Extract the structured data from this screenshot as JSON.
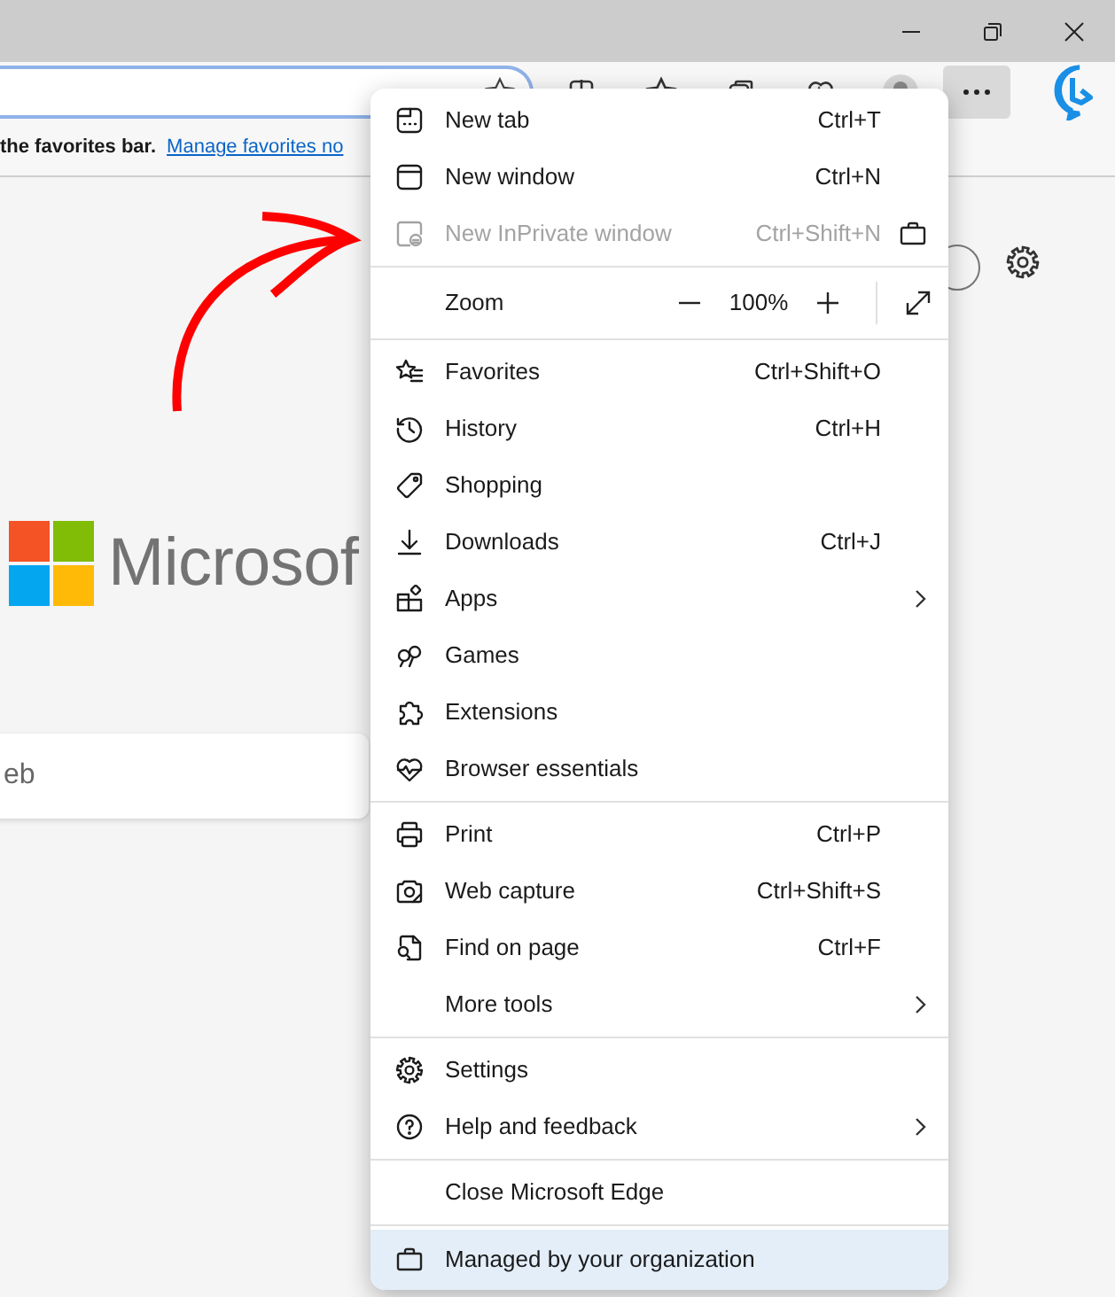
{
  "favorites_bar": {
    "message": "the favorites bar.",
    "link": "Manage favorites no"
  },
  "page": {
    "logo_text": "Microsof",
    "search_text": "eb"
  },
  "menu": {
    "groups": [
      [
        {
          "kind": "item",
          "label": "New tab",
          "shortcut": "Ctrl+T",
          "disabled": false,
          "submenu": false
        },
        {
          "kind": "item",
          "label": "New window",
          "shortcut": "Ctrl+N",
          "disabled": false,
          "submenu": false
        },
        {
          "kind": "item",
          "label": "New InPrivate window",
          "shortcut": "Ctrl+Shift+N",
          "disabled": true,
          "submenu": false,
          "badge": true
        }
      ],
      [
        {
          "kind": "zoom",
          "label": "Zoom",
          "value": "100%",
          "disabled": false,
          "submenu": false
        }
      ],
      [
        {
          "kind": "item",
          "label": "Favorites",
          "shortcut": "Ctrl+Shift+O",
          "disabled": false,
          "submenu": false
        },
        {
          "kind": "item",
          "label": "History",
          "shortcut": "Ctrl+H",
          "disabled": false,
          "submenu": false
        },
        {
          "kind": "item",
          "label": "Shopping",
          "disabled": false,
          "submenu": false
        },
        {
          "kind": "item",
          "label": "Downloads",
          "shortcut": "Ctrl+J",
          "disabled": false,
          "submenu": false
        },
        {
          "kind": "item",
          "label": "Apps",
          "disabled": false,
          "submenu": true
        },
        {
          "kind": "item",
          "label": "Games",
          "disabled": false,
          "submenu": false
        },
        {
          "kind": "item",
          "label": "Extensions",
          "disabled": false,
          "submenu": false
        },
        {
          "kind": "item",
          "label": "Browser essentials",
          "disabled": false,
          "submenu": false
        }
      ],
      [
        {
          "kind": "item",
          "label": "Print",
          "shortcut": "Ctrl+P",
          "disabled": false,
          "submenu": false
        },
        {
          "kind": "item",
          "label": "Web capture",
          "shortcut": "Ctrl+Shift+S",
          "disabled": false,
          "submenu": false
        },
        {
          "kind": "item",
          "label": "Find on page",
          "shortcut": "Ctrl+F",
          "disabled": false,
          "submenu": false
        },
        {
          "kind": "item",
          "label": "More tools",
          "disabled": false,
          "submenu": true
        }
      ],
      [
        {
          "kind": "item",
          "label": "Settings",
          "disabled": false,
          "submenu": false
        },
        {
          "kind": "item",
          "label": "Help and feedback",
          "disabled": false,
          "submenu": true
        }
      ],
      [
        {
          "kind": "item",
          "label": "Close Microsoft Edge",
          "disabled": false,
          "submenu": false
        }
      ]
    ],
    "footer": {
      "label": "Managed by your organization",
      "highlighted": true
    }
  }
}
